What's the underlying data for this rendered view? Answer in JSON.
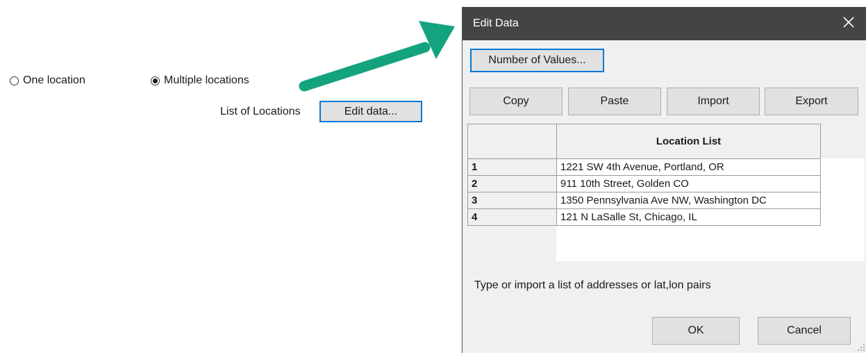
{
  "radios": {
    "one_location": "One location",
    "multiple_locations": "Multiple locations",
    "selected": "multiple_locations"
  },
  "list_of_locations_label": "List of Locations",
  "edit_data_button": "Edit data...",
  "accent_color": "#0078d7",
  "arrow_color": "#14a37f",
  "dialog": {
    "title": "Edit Data",
    "close_icon": "close-icon",
    "number_of_values_button": "Number of Values...",
    "toolbar": {
      "copy": "Copy",
      "paste": "Paste",
      "import": "Import",
      "export": "Export"
    },
    "table": {
      "column_header": "Location List",
      "rows": [
        {
          "num": "1",
          "value": "1221 SW 4th Avenue, Portland, OR"
        },
        {
          "num": "2",
          "value": "911 10th Street, Golden CO"
        },
        {
          "num": "3",
          "value": "1350 Pennsylvania Ave NW, Washington DC"
        },
        {
          "num": "4",
          "value": "121 N LaSalle St, Chicago, IL"
        }
      ]
    },
    "hint": "Type or import a list of addresses or lat,lon pairs",
    "ok_button": "OK",
    "cancel_button": "Cancel"
  }
}
